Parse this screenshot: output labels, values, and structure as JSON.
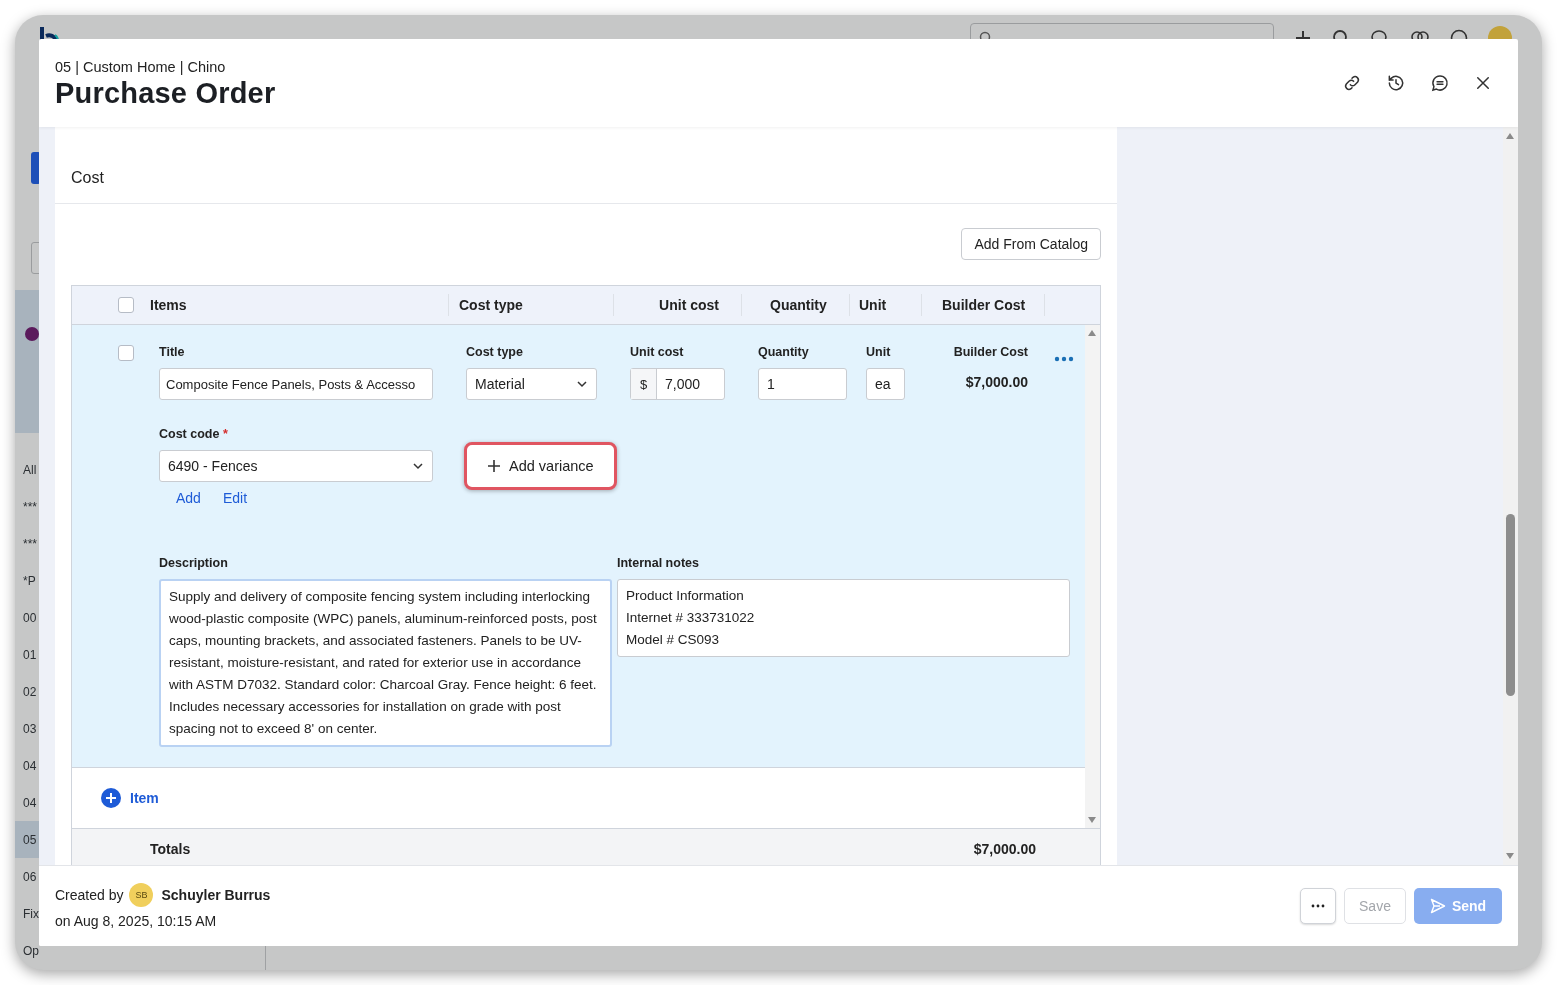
{
  "app": {
    "sidebar": [
      {
        "text": "All",
        "selected": false
      },
      {
        "text": "***",
        "selected": false
      },
      {
        "text": "***",
        "selected": false
      },
      {
        "text": "*P",
        "selected": false
      },
      {
        "text": "00",
        "selected": false
      },
      {
        "text": "01",
        "selected": false
      },
      {
        "text": "02",
        "selected": false
      },
      {
        "text": "03",
        "selected": false
      },
      {
        "text": "04",
        "selected": false
      },
      {
        "text": "04",
        "selected": false
      },
      {
        "text": "05",
        "selected": true
      },
      {
        "text": "06",
        "selected": false
      },
      {
        "text": "Fix",
        "selected": false
      },
      {
        "text": "Op",
        "selected": false
      }
    ]
  },
  "modal": {
    "breadcrumb": "05 | Custom Home | Chino",
    "title": "Purchase Order"
  },
  "cost": {
    "title": "Cost",
    "add_from_catalog": "Add From Catalog",
    "select_all_checked": false,
    "columns": [
      "Items",
      "Cost type",
      "Unit cost",
      "Quantity",
      "Unit",
      "Builder Cost"
    ],
    "items": [
      {
        "checked": false,
        "title_label": "Title",
        "title": "Composite Fence Panels, Posts & Accesso",
        "cost_type_label": "Cost type",
        "cost_type": "Material",
        "unit_cost_label": "Unit cost",
        "currency": "$",
        "unit_cost": "7,000",
        "quantity_label": "Quantity",
        "quantity": "1",
        "unit_label": "Unit",
        "unit": "ea",
        "builder_cost_label": "Builder Cost",
        "builder_cost": "$7,000.00",
        "cost_code_label": "Cost code",
        "required_mark": "*",
        "cost_code": "6490 - Fences",
        "cost_code_links": [
          "Add",
          "Edit"
        ],
        "add_variance": "Add variance",
        "description_label": "Description",
        "description": "Supply and delivery of composite fencing system including interlocking wood-plastic composite (WPC) panels, aluminum-reinforced posts, post caps, mounting brackets, and associated fasteners. Panels to be UV-resistant, moisture-resistant, and rated for exterior use in accordance with ASTM D7032. Standard color: Charcoal Gray. Fence height: 6 feet. Includes necessary accessories for installation on grade with post spacing not to exceed 8' on center.",
        "notes_label": "Internal notes",
        "notes": [
          "Product Information",
          "Internet # 333731022",
          "Model # CS093"
        ]
      }
    ],
    "add_item": "Item",
    "totals": {
      "label": "Totals",
      "value": "$7,000.00"
    }
  },
  "footer": {
    "created_by": "Created by",
    "initials": "SB",
    "name": "Schuyler Burrus",
    "date": "on Aug 8, 2025, 10:15 AM",
    "save": {
      "label": "Save",
      "disabled": true
    },
    "send": {
      "label": "Send",
      "disabled": true
    }
  }
}
